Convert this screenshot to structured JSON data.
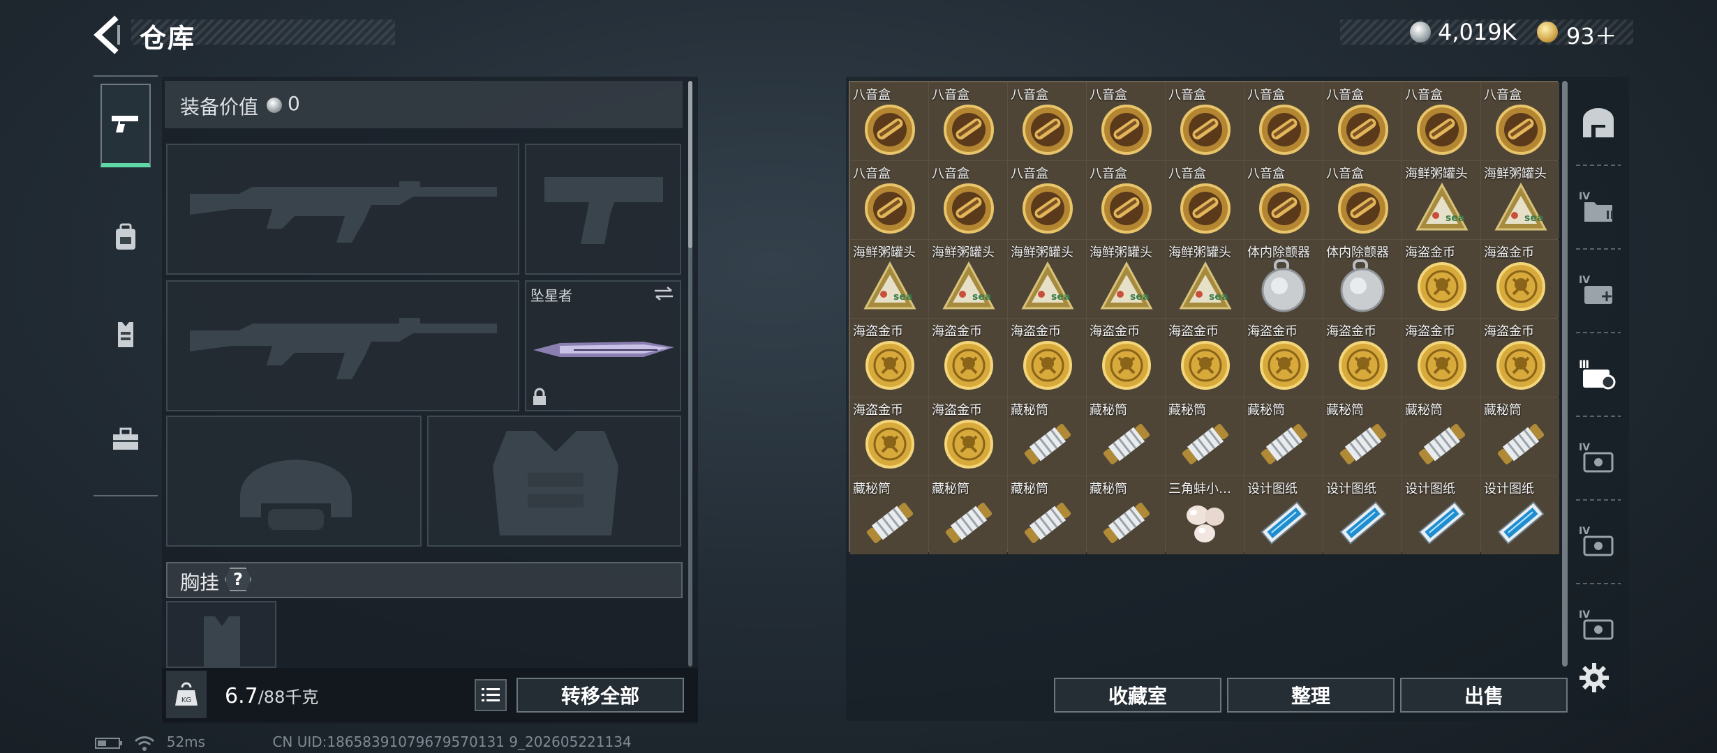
{
  "header": {
    "title": "仓库",
    "currency": [
      {
        "icon": "silver-coin-icon",
        "value": "4,019K"
      },
      {
        "icon": "gold-coin-icon",
        "value": "93＋"
      }
    ],
    "small_tag": "~~~ ~~~"
  },
  "left_tabs": [
    {
      "icon": "pistol-icon",
      "active": true
    },
    {
      "icon": "backpack-icon",
      "active": false
    },
    {
      "icon": "vest-icon",
      "active": false
    },
    {
      "icon": "toolbox-icon",
      "active": false
    }
  ],
  "equipment": {
    "value_label": "装备价值",
    "value": "0",
    "melee_slot_label": "坠星者",
    "chest_rig_label": "胸挂",
    "chest_rig_badge": "?"
  },
  "weight": {
    "current": "6.7",
    "max_text": "/88千克",
    "icon_text": "KG"
  },
  "buttons": {
    "transfer_all": "转移全部",
    "collection": "收藏室",
    "sort": "整理",
    "sell": "出售"
  },
  "inventory": [
    {
      "name": "八音盒",
      "art": "music-box"
    },
    {
      "name": "八音盒",
      "art": "music-box"
    },
    {
      "name": "八音盒",
      "art": "music-box"
    },
    {
      "name": "八音盒",
      "art": "music-box"
    },
    {
      "name": "八音盒",
      "art": "music-box"
    },
    {
      "name": "八音盒",
      "art": "music-box"
    },
    {
      "name": "八音盒",
      "art": "music-box"
    },
    {
      "name": "八音盒",
      "art": "music-box"
    },
    {
      "name": "八音盒",
      "art": "music-box"
    },
    {
      "name": "八音盒",
      "art": "music-box"
    },
    {
      "name": "八音盒",
      "art": "music-box"
    },
    {
      "name": "八音盒",
      "art": "music-box"
    },
    {
      "name": "八音盒",
      "art": "music-box"
    },
    {
      "name": "八音盒",
      "art": "music-box"
    },
    {
      "name": "八音盒",
      "art": "music-box"
    },
    {
      "name": "八音盒",
      "art": "music-box"
    },
    {
      "name": "海鲜粥罐头",
      "art": "seafood-can"
    },
    {
      "name": "海鲜粥罐头",
      "art": "seafood-can"
    },
    {
      "name": "海鲜粥罐头",
      "art": "seafood-can"
    },
    {
      "name": "海鲜粥罐头",
      "art": "seafood-can"
    },
    {
      "name": "海鲜粥罐头",
      "art": "seafood-can"
    },
    {
      "name": "海鲜粥罐头",
      "art": "seafood-can"
    },
    {
      "name": "海鲜粥罐头",
      "art": "seafood-can"
    },
    {
      "name": "体内除颤器",
      "art": "defibrillator"
    },
    {
      "name": "体内除颤器",
      "art": "defibrillator"
    },
    {
      "name": "海盗金币",
      "art": "pirate-coin"
    },
    {
      "name": "海盗金币",
      "art": "pirate-coin"
    },
    {
      "name": "海盗金币",
      "art": "pirate-coin"
    },
    {
      "name": "海盗金币",
      "art": "pirate-coin"
    },
    {
      "name": "海盗金币",
      "art": "pirate-coin"
    },
    {
      "name": "海盗金币",
      "art": "pirate-coin"
    },
    {
      "name": "海盗金币",
      "art": "pirate-coin"
    },
    {
      "name": "海盗金币",
      "art": "pirate-coin"
    },
    {
      "name": "海盗金币",
      "art": "pirate-coin"
    },
    {
      "name": "海盗金币",
      "art": "pirate-coin"
    },
    {
      "name": "海盗金币",
      "art": "pirate-coin"
    },
    {
      "name": "海盗金币",
      "art": "pirate-coin"
    },
    {
      "name": "海盗金币",
      "art": "pirate-coin"
    },
    {
      "name": "藏秘筒",
      "art": "cryptex"
    },
    {
      "name": "藏秘筒",
      "art": "cryptex"
    },
    {
      "name": "藏秘筒",
      "art": "cryptex"
    },
    {
      "name": "藏秘筒",
      "art": "cryptex"
    },
    {
      "name": "藏秘筒",
      "art": "cryptex"
    },
    {
      "name": "藏秘筒",
      "art": "cryptex"
    },
    {
      "name": "藏秘筒",
      "art": "cryptex"
    },
    {
      "name": "藏秘筒",
      "art": "cryptex"
    },
    {
      "name": "藏秘筒",
      "art": "cryptex"
    },
    {
      "name": "藏秘筒",
      "art": "cryptex"
    },
    {
      "name": "藏秘筒",
      "art": "cryptex"
    },
    {
      "name": "三角蚌小…",
      "art": "pearls"
    },
    {
      "name": "设计图纸",
      "art": "blueprint"
    },
    {
      "name": "设计图纸",
      "art": "blueprint"
    },
    {
      "name": "设计图纸",
      "art": "blueprint"
    },
    {
      "name": "设计图纸",
      "art": "blueprint"
    }
  ],
  "right_tabs": [
    {
      "icon": "vault-icon"
    },
    {
      "icon": "storage-iv-icon",
      "badge": "IV"
    },
    {
      "icon": "storage-iv-add-icon",
      "badge": "IV"
    },
    {
      "icon": "equipment-storage-icon",
      "badge": "Ⅲ"
    },
    {
      "icon": "storage-iv-icon",
      "badge": "IV"
    },
    {
      "icon": "storage-iv-icon",
      "badge": "IV"
    },
    {
      "icon": "storage-iv-icon",
      "badge": "IV"
    }
  ],
  "footer": {
    "ping": "52ms",
    "uid": "CN UID:18658391079679570131 9_202605221134"
  },
  "colors": {
    "active_tab_accent": "#5fd6a6",
    "inventory_cell": "#4e4537"
  }
}
